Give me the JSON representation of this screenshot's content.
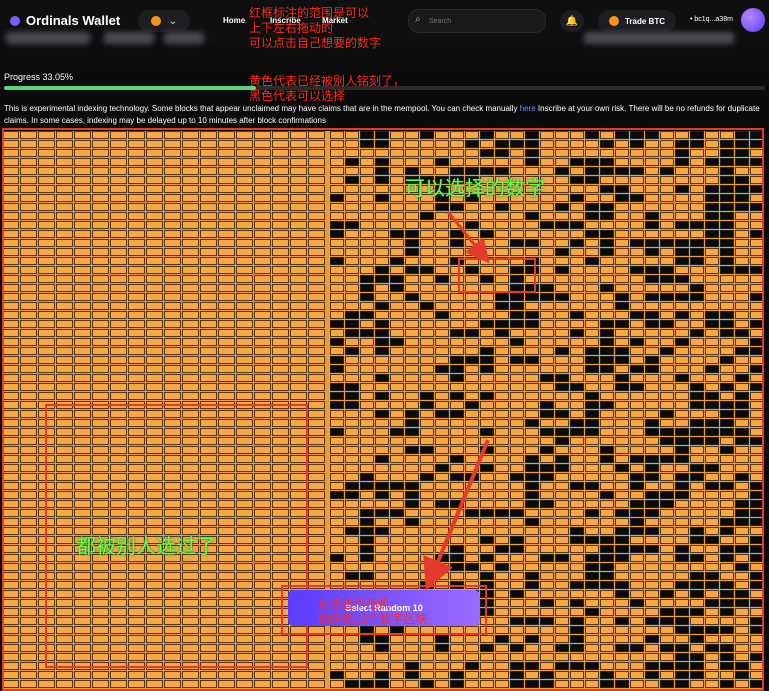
{
  "app": {
    "title": "Ordinals Wallet",
    "nav": [
      "Home",
      "Inscribe",
      "Market"
    ],
    "search_placeholder": "Search",
    "trade_label": "Trade BTC",
    "wallet_address": "• bc1q...a38m"
  },
  "page": {
    "progress_label": "Progress 33.05%",
    "progress_fraction": 0.3305,
    "notice_before_link": "This is experimental indexing technology. Some blocks that appear unclaimed may have claims that are in the mempool. You can check manually ",
    "notice_link": "here",
    "notice_after_link": " Inscribe at your own risk. There will be no refunds for duplicate claims. In some cases, indexing may be delayed up to 10 minutes after block confirmations",
    "random_button": "Select Random 10"
  },
  "annotations": {
    "red_top": "红框标注的范围是可以\n上下左右拖动的\n可以点击自己想要的数字",
    "red_legend": "黄色代表已经被别人铭刻了，\n黑色代表可以选择",
    "green_selectable": "可以选择的数字",
    "green_taken": "都被别人选过了",
    "red_button": "点击这个随机\n的选择10个数字区块"
  },
  "colors": {
    "taken": "#f6a845",
    "available": "#0b0b0b",
    "accent": "#7b5cff",
    "annotation_red": "#ff2a1a",
    "annotation_green": "#6cff4a"
  },
  "icons": [
    "ordinals-logo-icon",
    "bitcoin-icon",
    "chevron-down-icon",
    "search-icon",
    "bell-icon",
    "avatar"
  ]
}
